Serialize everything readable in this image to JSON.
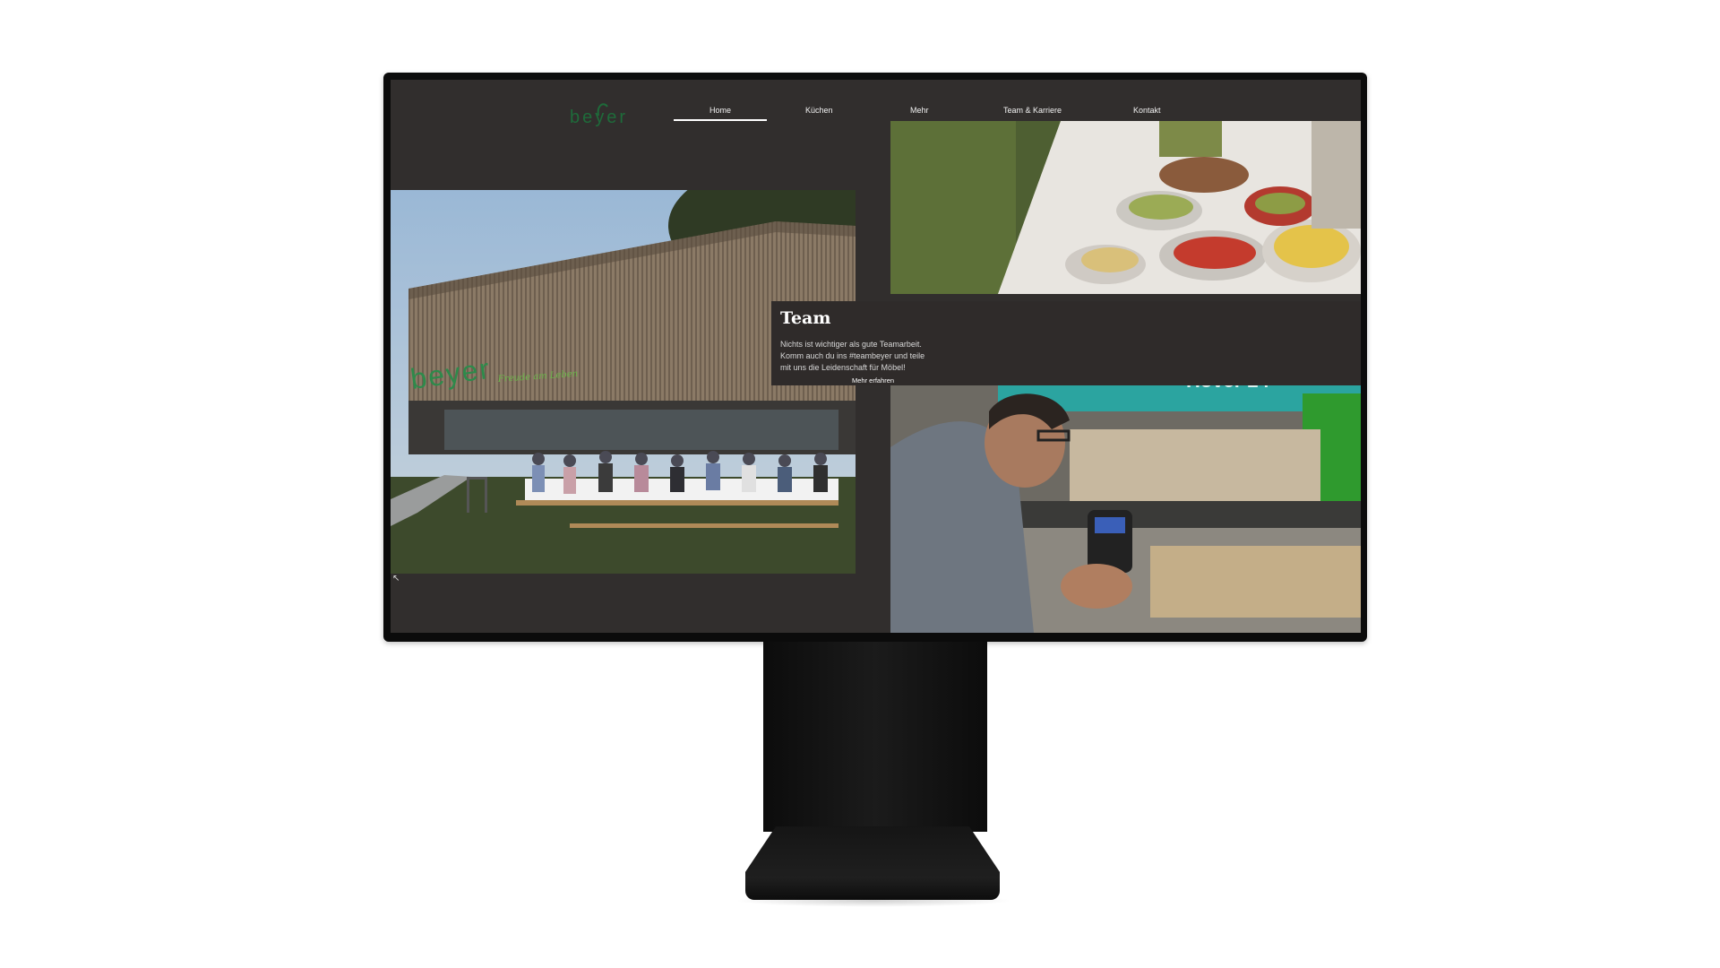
{
  "nav": {
    "logo_text": "beyer",
    "items": [
      {
        "label": "Home",
        "active": true
      },
      {
        "label": "Küchen",
        "active": false
      },
      {
        "label": "Mehr",
        "active": false
      },
      {
        "label": "Team & Karriere",
        "active": false
      },
      {
        "label": "Kontakt",
        "active": false
      }
    ]
  },
  "team": {
    "title": "Team",
    "text": "Nichts ist wichtiger als gute Teamarbeit. Komm auch du ins #teambeyer und teile mit uns die Leidenschaft für Möbel!",
    "link_label": "Mehr erfahren"
  },
  "colors": {
    "background": "#312e2d",
    "brand_green": "#1e6b3a",
    "text": "#ffffff"
  }
}
